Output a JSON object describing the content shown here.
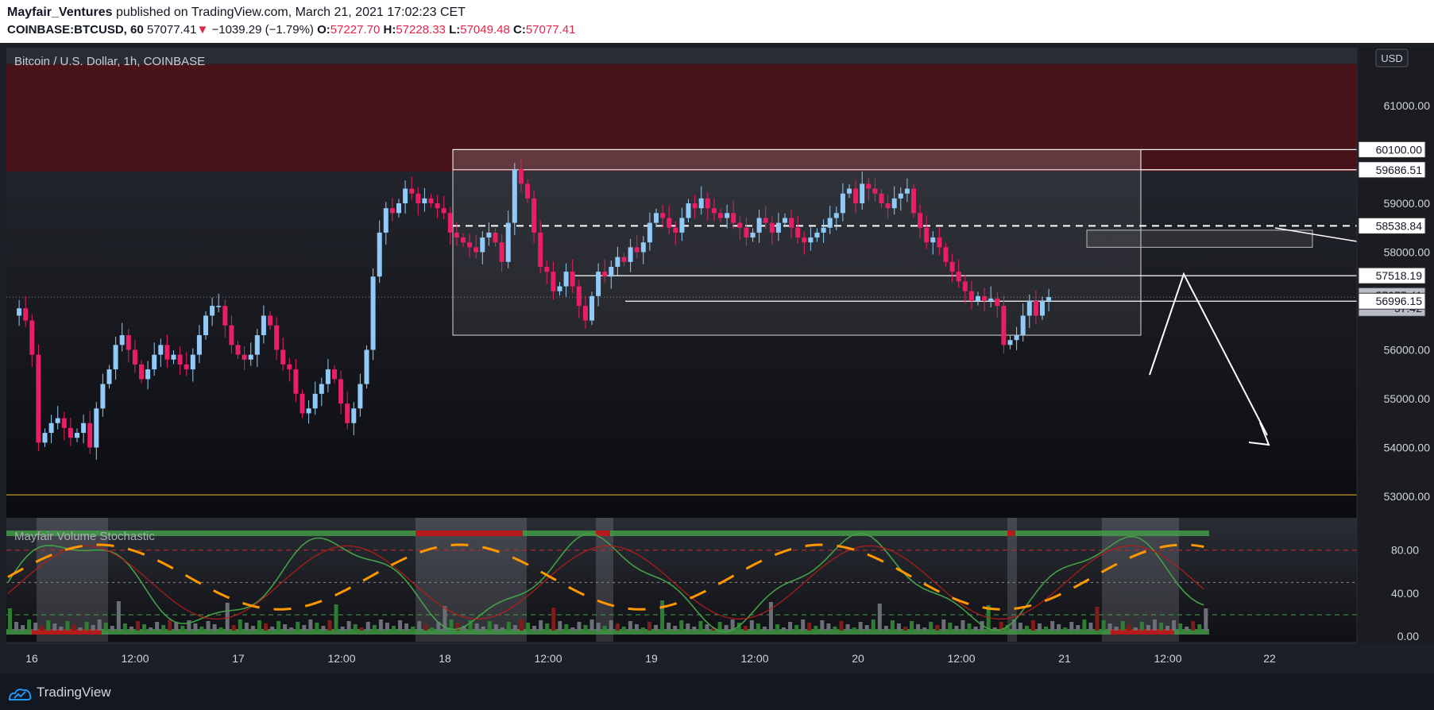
{
  "header": {
    "author": "Mayfair_Ventures",
    "published": " published on TradingView.com, March 21, 2021 17:02:23 CET",
    "symbol": "COINBASE:BTCUSD, 60",
    "last": "57077.41",
    "change": "−1039.29 (−1.79%)",
    "o_label": "O:",
    "o": "57227.70",
    "h_label": "H:",
    "h": "57228.33",
    "l_label": "L:",
    "l": "57049.48",
    "c_label": "C:",
    "c": "57077.41"
  },
  "chart_title": "Bitcoin / U.S. Dollar, 1h, COINBASE",
  "currency": "USD",
  "indicator_name": "Mayfair Volume Stochastic",
  "colors": {
    "up": "#90caf9",
    "down": "#e91e63",
    "resistance_zone": "#4a1218",
    "support_line": "#c79a2b",
    "stoch_green": "#43a047",
    "stoch_red": "#b71c1c",
    "stoch_orange": "#ff9800"
  },
  "chart_data": {
    "type": "candlestick",
    "timeframe": "1h",
    "x_tick_labels": [
      "16",
      "12:00",
      "17",
      "12:00",
      "18",
      "12:00",
      "19",
      "12:00",
      "20",
      "12:00",
      "21",
      "12:00",
      "22"
    ],
    "y_ticks": [
      53000,
      54000,
      55000,
      56000,
      57000,
      58000,
      59000,
      60000,
      61000
    ],
    "y_tick_labels": [
      "53000.00",
      "54000.00",
      "55000.00",
      "56000.00",
      "58000.00",
      "59000.00",
      "61000.00"
    ],
    "ylim": [
      52700,
      62300
    ],
    "price_labels": [
      {
        "text": "60100.00",
        "value": 60100,
        "style": "white-box"
      },
      {
        "text": "59686.51",
        "value": 59686.51,
        "style": "white-box"
      },
      {
        "text": "58538.84",
        "value": 58538.84,
        "style": "white-box"
      },
      {
        "text": "57518.19",
        "value": 57518.19,
        "style": "white-box"
      },
      {
        "text": "57077.41",
        "value": 57077.41,
        "style": "gray-box",
        "sub": "57:42"
      },
      {
        "text": "56996.15",
        "value": 56996.15,
        "style": "white-box"
      }
    ],
    "annotations": {
      "resistance_zone": [
        59650,
        61850
      ],
      "consolidation_box": [
        56300,
        60100
      ],
      "top_shaded": [
        59686.51,
        60100
      ],
      "mid_dashed": 58538.84,
      "support_line": 53030,
      "projection_arrow": "down"
    },
    "candles_ohlc_sample": [
      {
        "o": 56700,
        "h": 57000,
        "l": 56400,
        "c": 56850
      },
      {
        "o": 56850,
        "h": 57200,
        "l": 56600,
        "c": 56600
      },
      {
        "o": 56600,
        "h": 56700,
        "l": 55800,
        "c": 55900
      },
      {
        "o": 55900,
        "h": 56000,
        "l": 54000,
        "c": 54100
      }
    ],
    "indicator": {
      "name": "Mayfair Volume Stochastic",
      "y_tick_labels": [
        "80.00",
        "40.00",
        "0.00"
      ],
      "levels": [
        80,
        50,
        20
      ],
      "ylim": [
        -5,
        110
      ]
    }
  }
}
